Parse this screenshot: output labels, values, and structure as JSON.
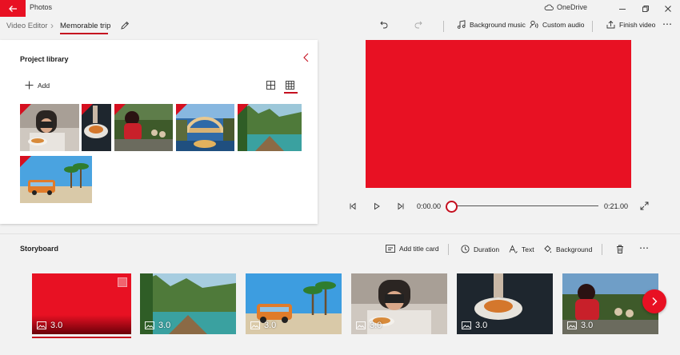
{
  "window": {
    "app_title": "Photos",
    "onedrive_label": "OneDrive",
    "accent": "#e81123"
  },
  "nav": {
    "breadcrumb_root": "Video Editor",
    "breadcrumb_current": "Memorable trip"
  },
  "toolbar": {
    "background_music": "Background music",
    "custom_audio": "Custom audio",
    "finish_video": "Finish video"
  },
  "library": {
    "title": "Project library",
    "add_label": "Add",
    "items": [
      {
        "name": "photographer-food"
      },
      {
        "name": "pasta-plate"
      },
      {
        "name": "mascot-parade"
      },
      {
        "name": "bridge-night"
      },
      {
        "name": "boat-lagoon"
      },
      {
        "name": "beach-bus"
      }
    ]
  },
  "player": {
    "current_time": "0:00.00",
    "total_time": "0:21.00",
    "progress": 0
  },
  "storyboard": {
    "title": "Storyboard",
    "add_title_card": "Add title card",
    "duration": "Duration",
    "text": "Text",
    "background": "Background",
    "clips": [
      {
        "duration": "3.0",
        "kind": "title-card"
      },
      {
        "duration": "3.0",
        "kind": "boat-lagoon"
      },
      {
        "duration": "3.0",
        "kind": "beach-bus"
      },
      {
        "duration": "3.0",
        "kind": "photographer-food"
      },
      {
        "duration": "3.0",
        "kind": "pasta-plate"
      },
      {
        "duration": "3.0",
        "kind": "mascot-parade"
      }
    ]
  }
}
